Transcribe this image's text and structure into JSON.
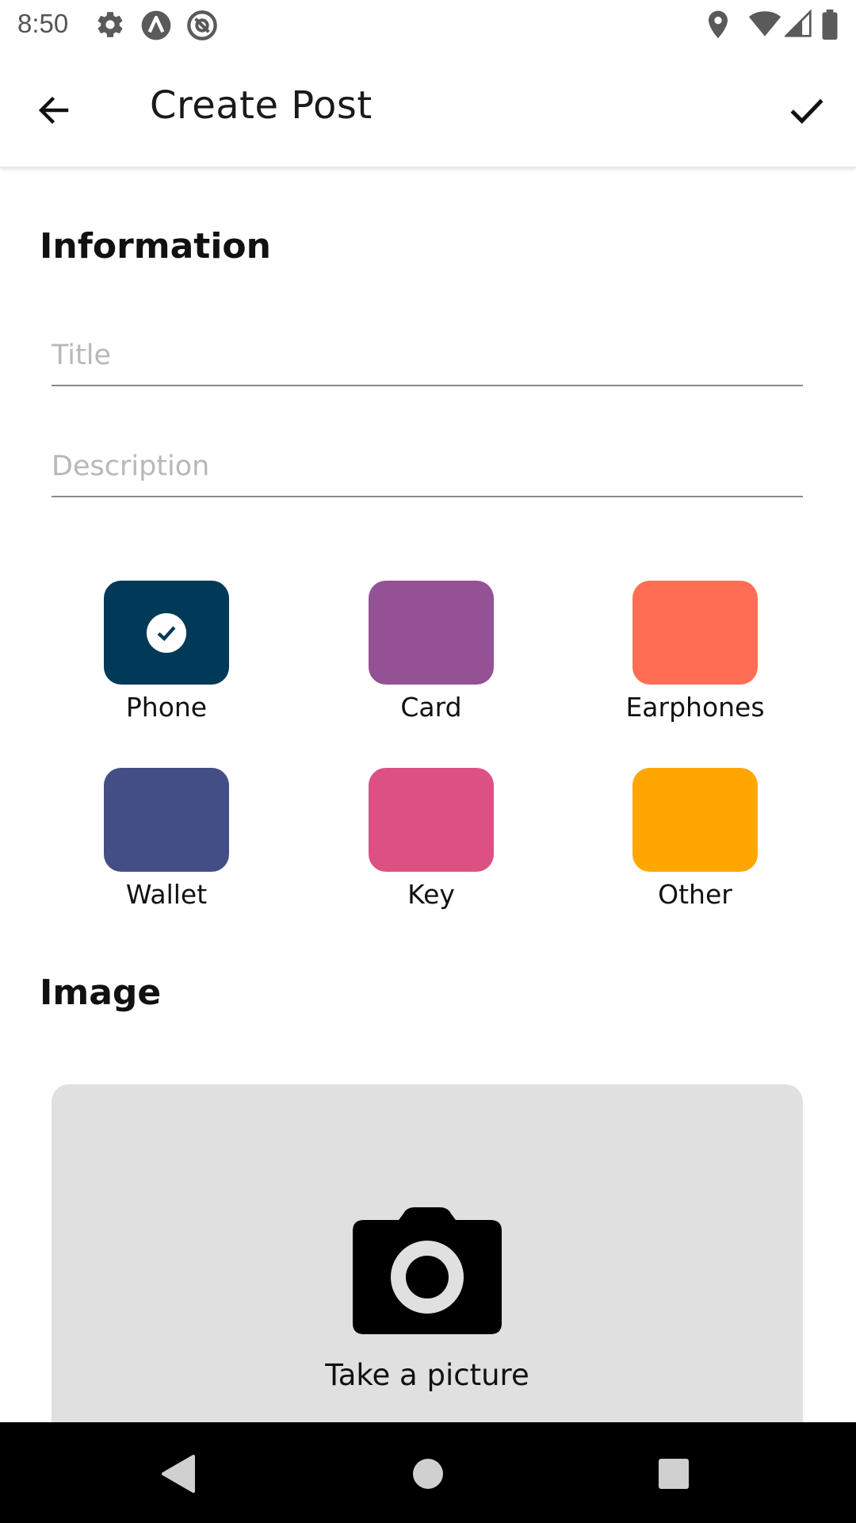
{
  "status_bar": {
    "time": "8:50",
    "left_icons": [
      "gear-icon",
      "a-badge-icon",
      "at-sign-icon"
    ],
    "right_icons": [
      "location-pin-icon",
      "wifi-icon",
      "signal-icon",
      "battery-icon"
    ]
  },
  "app_bar": {
    "title": "Create Post",
    "back_icon": "arrow-back-icon",
    "confirm_icon": "check-icon"
  },
  "information": {
    "heading": "Information",
    "title_field": {
      "value": "",
      "placeholder": "Title"
    },
    "description_field": {
      "value": "",
      "placeholder": "Description"
    }
  },
  "categories": [
    {
      "label": "Phone",
      "color": "#013a58",
      "selected": true
    },
    {
      "label": "Card",
      "color": "#955196",
      "selected": false
    },
    {
      "label": "Earphones",
      "color": "#ff6e54",
      "selected": false
    },
    {
      "label": "Wallet",
      "color": "#444e86",
      "selected": false
    },
    {
      "label": "Key",
      "color": "#dd5182",
      "selected": false
    },
    {
      "label": "Other",
      "color": "#ffa600",
      "selected": false
    }
  ],
  "image_section": {
    "heading": "Image",
    "button_label": "Take a picture",
    "icon": "camera-icon"
  },
  "nav_bar": {
    "items": [
      "back-triangle-icon",
      "home-circle-icon",
      "recents-square-icon"
    ]
  }
}
